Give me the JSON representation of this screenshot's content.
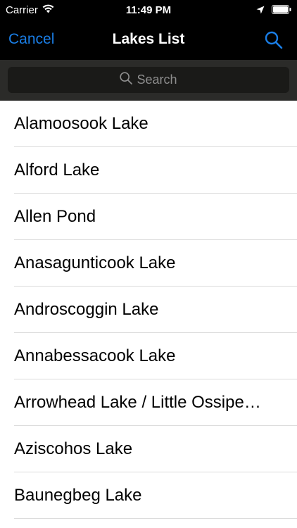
{
  "status_bar": {
    "carrier": "Carrier",
    "time": "11:49 PM"
  },
  "nav": {
    "cancel_label": "Cancel",
    "title": "Lakes List",
    "accent_color": "#1a7ee6"
  },
  "search": {
    "placeholder": "Search"
  },
  "lakes": [
    {
      "name": "Alamoosook Lake"
    },
    {
      "name": "Alford Lake"
    },
    {
      "name": "Allen Pond"
    },
    {
      "name": "Anasagunticook Lake"
    },
    {
      "name": "Androscoggin Lake"
    },
    {
      "name": "Annabessacook Lake"
    },
    {
      "name": "Arrowhead Lake / Little Ossipe…"
    },
    {
      "name": "Aziscohos Lake"
    },
    {
      "name": "Baunegbeg Lake"
    }
  ],
  "icons": {
    "wifi": "wifi-icon",
    "location": "location-arrow-icon",
    "battery": "battery-icon",
    "search": "search-icon"
  }
}
